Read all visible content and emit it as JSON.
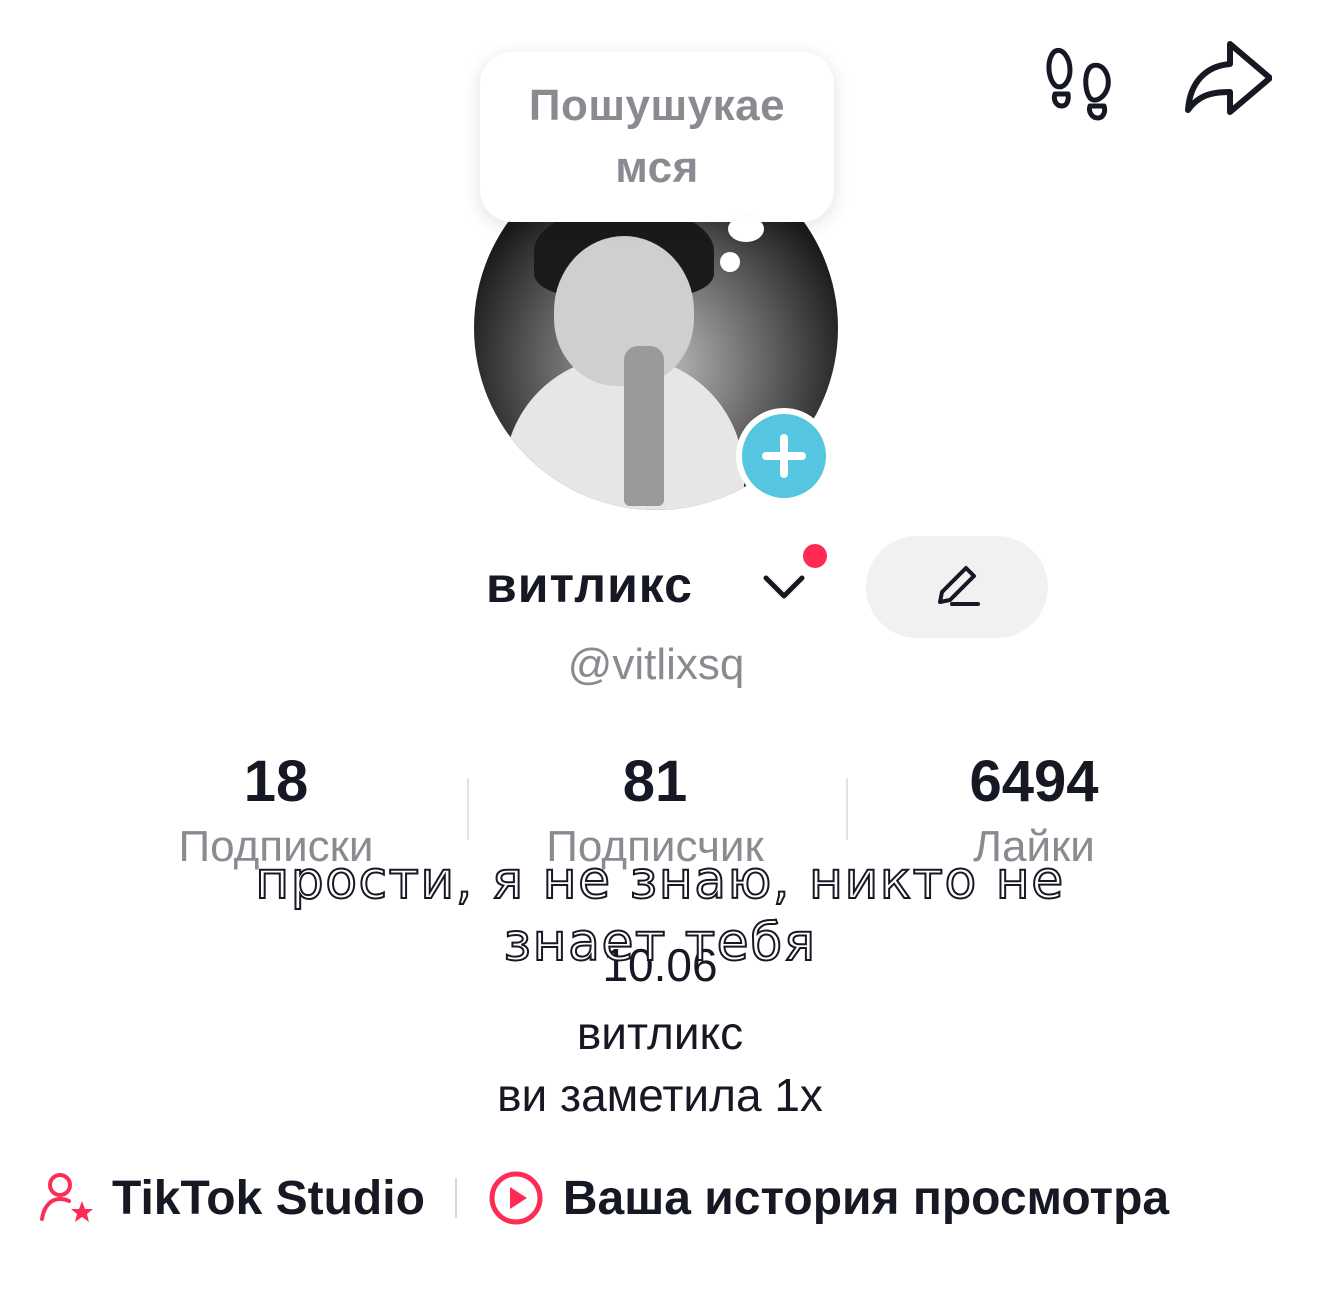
{
  "bubble": {
    "line1": "Пошушукае",
    "line2": "мся"
  },
  "profile": {
    "name": "витликс",
    "handle": "@vitlixsq"
  },
  "stats": [
    {
      "value": "18",
      "label": "Подписки"
    },
    {
      "value": "81",
      "label": "Подписчик"
    },
    {
      "value": "6494",
      "label": "Лайки"
    }
  ],
  "overlay": {
    "line1": "прости, я не знаю, никто не",
    "line2": "знает тебя"
  },
  "bio": {
    "line1": "10.06",
    "line2": "витликс",
    "line3": "ви заметила 1х"
  },
  "links": {
    "studio": "TikTok Studio",
    "history": "Ваша история просмотра"
  },
  "colors": {
    "accent": "#fe2c55",
    "add_button": "#56c5e0",
    "muted_text": "#8a8b91"
  },
  "icons": [
    "footprints-icon",
    "share-icon",
    "plus-icon",
    "chevron-down-icon",
    "pencil-icon",
    "creator-icon",
    "play-circle-icon"
  ]
}
